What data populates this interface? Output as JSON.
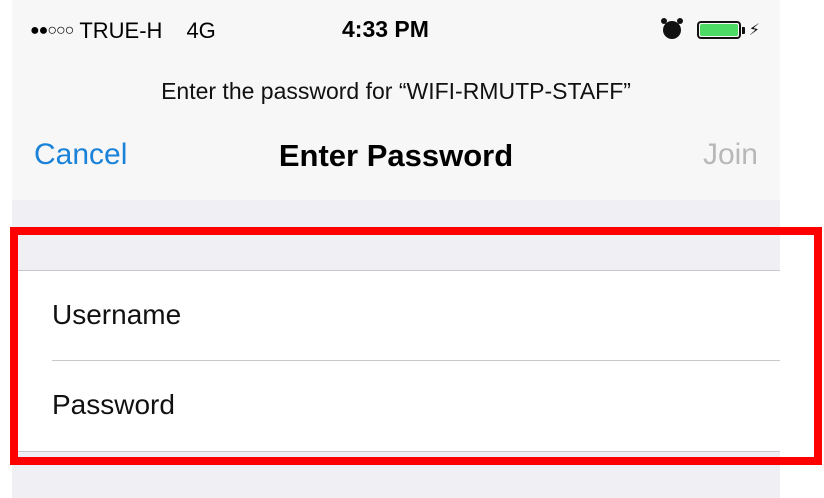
{
  "status_bar": {
    "signal": "●●○○○",
    "carrier": "TRUE-H",
    "network": "4G",
    "time": "4:33 PM",
    "icons": [
      "alarm-icon",
      "battery-icon",
      "charging-icon"
    ],
    "battery_level": 1.0
  },
  "prompt": "Enter the password for “WIFI-RMUTP-STAFF”",
  "nav": {
    "cancel_label": "Cancel",
    "title": "Enter Password",
    "join_label": "Join"
  },
  "form": {
    "username_label": "Username",
    "username_value": "",
    "password_label": "Password",
    "password_value": ""
  },
  "colors": {
    "accent": "#1a82d8",
    "disabled": "#b8b8b8",
    "battery": "#4cd964",
    "highlight": "#ff0000",
    "grouped_background": "#efeff4"
  }
}
